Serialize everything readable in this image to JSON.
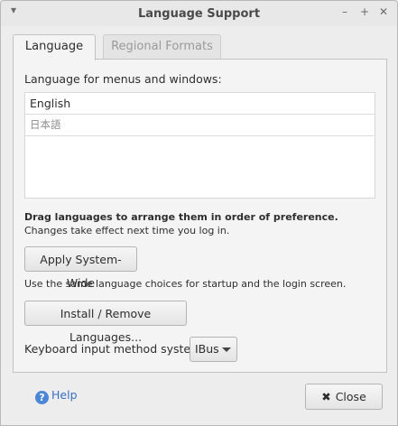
{
  "window": {
    "title": "Language Support",
    "menu_glyph": "▾",
    "min_glyph": "–",
    "max_glyph": "+",
    "close_glyph": "✕"
  },
  "tabs": [
    {
      "label": "Language",
      "active": true
    },
    {
      "label": "Regional Formats",
      "active": false
    }
  ],
  "language_tab": {
    "list_heading": "Language for menus and windows:",
    "languages": [
      "English",
      "日本語"
    ],
    "drag_hint": "Drag languages to arrange them in order of preference.",
    "effect_note": "Changes take effect next time you log in.",
    "apply_button": "Apply System-Wide",
    "apply_note": "Use the same language choices for startup and the login screen.",
    "install_button": "Install / Remove Languages...",
    "input_method_label": "Keyboard input method system:",
    "input_method_value": "IBus"
  },
  "footer": {
    "help_label": "Help",
    "help_icon_glyph": "?",
    "close_label": "Close",
    "close_icon_glyph": "✖"
  },
  "colors": {
    "background": "#ededed",
    "panel": "#f4f4f4",
    "link": "#3a6fbf",
    "help_icon": "#4a87d6"
  }
}
